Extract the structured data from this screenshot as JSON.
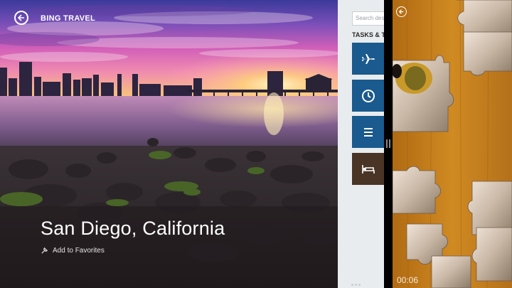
{
  "travel": {
    "app_title": "BING TRAVEL",
    "city_name": "San Diego, California",
    "favorites_label": "Add to Favorites"
  },
  "tasks_panel": {
    "search_placeholder": "Search destinations",
    "title": "TASKS & TOOLS",
    "tiles": [
      {
        "icon": "airplane-icon",
        "color": "#1a5a8e"
      },
      {
        "icon": "clock-icon",
        "color": "#1a5a8e"
      },
      {
        "icon": "list-icon",
        "color": "#1a5a8e"
      },
      {
        "icon": "bed-icon",
        "color": "#4a3425"
      }
    ]
  },
  "puzzle": {
    "timer": "00:06"
  }
}
